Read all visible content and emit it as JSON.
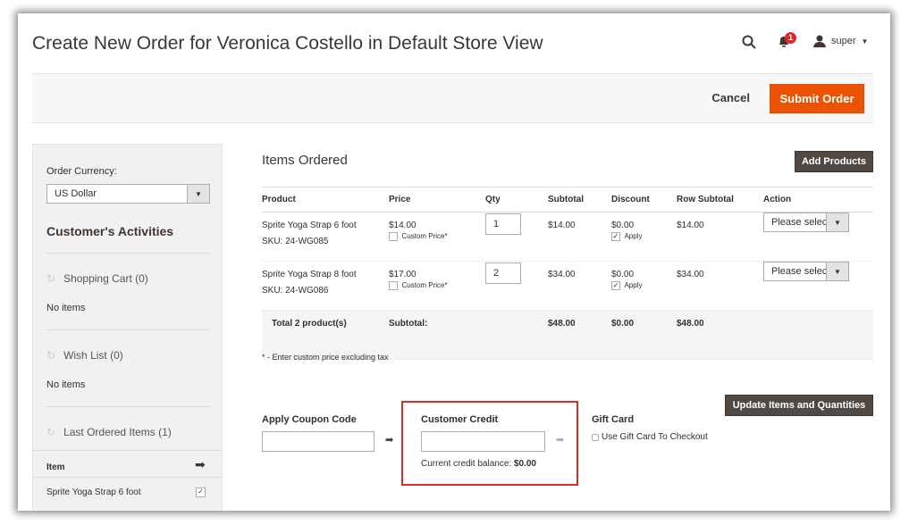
{
  "header": {
    "title": "Create New Order for Veronica Costello in Default Store View",
    "notification_count": "1",
    "user": "super"
  },
  "actions": {
    "cancel": "Cancel",
    "submit": "Submit Order"
  },
  "sidebar": {
    "currency_label": "Order Currency:",
    "currency_value": "US Dollar",
    "activities_title": "Customer's Activities",
    "sections": [
      {
        "title": "Shopping Cart (0)",
        "empty": "No items"
      },
      {
        "title": "Wish List (0)",
        "empty": "No items"
      },
      {
        "title": "Last Ordered Items (1)"
      }
    ],
    "last_ordered": {
      "header": "Item",
      "items": [
        {
          "name": "Sprite Yoga Strap 6 foot",
          "checked": true
        }
      ]
    }
  },
  "items": {
    "title": "Items Ordered",
    "add_products": "Add Products",
    "columns": [
      "Product",
      "Price",
      "Qty",
      "Subtotal",
      "Discount",
      "Row Subtotal",
      "Action"
    ],
    "rows": [
      {
        "name": "Sprite Yoga Strap 6 foot",
        "sku": "SKU: 24-WG085",
        "price": "$14.00",
        "custom_price": "Custom Price*",
        "qty": "1",
        "subtotal": "$14.00",
        "discount": "$0.00",
        "apply": "Apply",
        "row_subtotal": "$14.00",
        "action": "Please select"
      },
      {
        "name": "Sprite Yoga Strap 8 foot",
        "sku": "SKU: 24-WG086",
        "price": "$17.00",
        "custom_price": "Custom Price*",
        "qty": "2",
        "subtotal": "$34.00",
        "discount": "$0.00",
        "apply": "Apply",
        "row_subtotal": "$34.00",
        "action": "Please select"
      }
    ],
    "total": {
      "label": "Total 2 product(s)",
      "subtotal_label": "Subtotal:",
      "subtotal": "$48.00",
      "discount": "$0.00",
      "row_subtotal": "$48.00"
    },
    "note": "* - Enter custom price excluding tax",
    "update_button": "Update Items and Quantities"
  },
  "coupon": {
    "label": "Apply Coupon Code",
    "value": ""
  },
  "credit": {
    "label": "Customer Credit",
    "value": "",
    "balance_label": "Current credit balance:",
    "balance": "$0.00",
    "highlight_color": "#e02b27"
  },
  "giftcard": {
    "label": "Gift Card",
    "checkbox": "Use Gift Card To Checkout"
  }
}
